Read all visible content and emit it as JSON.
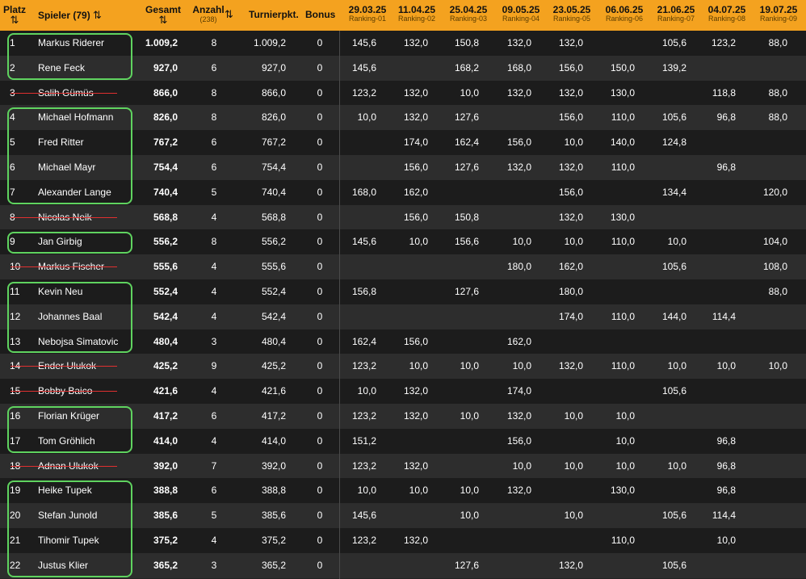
{
  "header": {
    "platz": "Platz",
    "spieler": "Spieler (79)",
    "gesamt": "Gesamt",
    "anzahl": "Anzahl",
    "anzahl_count": "(238)",
    "turnierpunkte": "Turnierpkt.",
    "bonus": "Bonus",
    "sort_symbol": "⇅",
    "rankings": [
      {
        "date": "29.03.25",
        "label": "Ranking-01"
      },
      {
        "date": "11.04.25",
        "label": "Ranking-02"
      },
      {
        "date": "25.04.25",
        "label": "Ranking-03"
      },
      {
        "date": "09.05.25",
        "label": "Ranking-04"
      },
      {
        "date": "23.05.25",
        "label": "Ranking-05"
      },
      {
        "date": "06.06.25",
        "label": "Ranking-06"
      },
      {
        "date": "21.06.25",
        "label": "Ranking-07"
      },
      {
        "date": "04.07.25",
        "label": "Ranking-08"
      },
      {
        "date": "19.07.25",
        "label": "Ranking-09"
      }
    ]
  },
  "colors": {
    "header_bg": "#f4a21f",
    "highlight_border": "#5fd35f",
    "strike": "#e03030"
  },
  "rows": [
    {
      "rank": "1",
      "name": "Markus Riderer",
      "total": "1.009,2",
      "count": "8",
      "points": "1.009,2",
      "bonus": "0",
      "r": [
        "145,6",
        "132,0",
        "150,8",
        "132,0",
        "132,0",
        "",
        "105,6",
        "123,2",
        "88,0"
      ],
      "struck": false
    },
    {
      "rank": "2",
      "name": "Rene Feck",
      "total": "927,0",
      "count": "6",
      "points": "927,0",
      "bonus": "0",
      "r": [
        "145,6",
        "",
        "168,2",
        "168,0",
        "156,0",
        "150,0",
        "139,2",
        "",
        ""
      ],
      "struck": false
    },
    {
      "rank": "3",
      "name": "Salih Gümüs",
      "total": "866,0",
      "count": "8",
      "points": "866,0",
      "bonus": "0",
      "r": [
        "123,2",
        "132,0",
        "10,0",
        "132,0",
        "132,0",
        "130,0",
        "",
        "118,8",
        "88,0"
      ],
      "struck": true
    },
    {
      "rank": "4",
      "name": "Michael Hofmann",
      "total": "826,0",
      "count": "8",
      "points": "826,0",
      "bonus": "0",
      "r": [
        "10,0",
        "132,0",
        "127,6",
        "",
        "156,0",
        "110,0",
        "105,6",
        "96,8",
        "88,0"
      ],
      "struck": false
    },
    {
      "rank": "5",
      "name": "Fred Ritter",
      "total": "767,2",
      "count": "6",
      "points": "767,2",
      "bonus": "0",
      "r": [
        "",
        "174,0",
        "162,4",
        "156,0",
        "10,0",
        "140,0",
        "124,8",
        "",
        ""
      ],
      "struck": false
    },
    {
      "rank": "6",
      "name": "Michael Mayr",
      "total": "754,4",
      "count": "6",
      "points": "754,4",
      "bonus": "0",
      "r": [
        "",
        "156,0",
        "127,6",
        "132,0",
        "132,0",
        "110,0",
        "",
        "96,8",
        ""
      ],
      "struck": false
    },
    {
      "rank": "7",
      "name": "Alexander Lange",
      "total": "740,4",
      "count": "5",
      "points": "740,4",
      "bonus": "0",
      "r": [
        "168,0",
        "162,0",
        "",
        "",
        "156,0",
        "",
        "134,4",
        "",
        "120,0"
      ],
      "struck": false
    },
    {
      "rank": "8",
      "name": "Nicolas Neik",
      "total": "568,8",
      "count": "4",
      "points": "568,8",
      "bonus": "0",
      "r": [
        "",
        "156,0",
        "150,8",
        "",
        "132,0",
        "130,0",
        "",
        "",
        ""
      ],
      "struck": true
    },
    {
      "rank": "9",
      "name": "Jan Girbig",
      "total": "556,2",
      "count": "8",
      "points": "556,2",
      "bonus": "0",
      "r": [
        "145,6",
        "10,0",
        "156,6",
        "10,0",
        "10,0",
        "110,0",
        "10,0",
        "",
        "104,0"
      ],
      "struck": false
    },
    {
      "rank": "10",
      "name": "Markus Fischer",
      "total": "555,6",
      "count": "4",
      "points": "555,6",
      "bonus": "0",
      "r": [
        "",
        "",
        "",
        "180,0",
        "162,0",
        "",
        "105,6",
        "",
        "108,0"
      ],
      "struck": true
    },
    {
      "rank": "11",
      "name": "Kevin Neu",
      "total": "552,4",
      "count": "4",
      "points": "552,4",
      "bonus": "0",
      "r": [
        "156,8",
        "",
        "127,6",
        "",
        "180,0",
        "",
        "",
        "",
        "88,0"
      ],
      "struck": false
    },
    {
      "rank": "12",
      "name": "Johannes Baal",
      "total": "542,4",
      "count": "4",
      "points": "542,4",
      "bonus": "0",
      "r": [
        "",
        "",
        "",
        "",
        "174,0",
        "110,0",
        "144,0",
        "114,4",
        ""
      ],
      "struck": false
    },
    {
      "rank": "13",
      "name": "Nebojsa Simatovic",
      "total": "480,4",
      "count": "3",
      "points": "480,4",
      "bonus": "0",
      "r": [
        "162,4",
        "156,0",
        "",
        "162,0",
        "",
        "",
        "",
        "",
        ""
      ],
      "struck": false
    },
    {
      "rank": "14",
      "name": "Ender Ulukok",
      "total": "425,2",
      "count": "9",
      "points": "425,2",
      "bonus": "0",
      "r": [
        "123,2",
        "10,0",
        "10,0",
        "10,0",
        "132,0",
        "110,0",
        "10,0",
        "10,0",
        "10,0"
      ],
      "struck": true
    },
    {
      "rank": "15",
      "name": "Bobby Baico",
      "total": "421,6",
      "count": "4",
      "points": "421,6",
      "bonus": "0",
      "r": [
        "10,0",
        "132,0",
        "",
        "174,0",
        "",
        "",
        "105,6",
        "",
        ""
      ],
      "struck": true
    },
    {
      "rank": "16",
      "name": "Florian Krüger",
      "total": "417,2",
      "count": "6",
      "points": "417,2",
      "bonus": "0",
      "r": [
        "123,2",
        "132,0",
        "10,0",
        "132,0",
        "10,0",
        "10,0",
        "",
        "",
        ""
      ],
      "struck": false
    },
    {
      "rank": "17",
      "name": "Tom Gröhlich",
      "total": "414,0",
      "count": "4",
      "points": "414,0",
      "bonus": "0",
      "r": [
        "151,2",
        "",
        "",
        "156,0",
        "",
        "10,0",
        "",
        "96,8",
        ""
      ],
      "struck": false
    },
    {
      "rank": "18",
      "name": "Adnan Ulukok",
      "total": "392,0",
      "count": "7",
      "points": "392,0",
      "bonus": "0",
      "r": [
        "123,2",
        "132,0",
        "",
        "10,0",
        "10,0",
        "10,0",
        "10,0",
        "96,8",
        ""
      ],
      "struck": true
    },
    {
      "rank": "19",
      "name": "Heike Tupek",
      "total": "388,8",
      "count": "6",
      "points": "388,8",
      "bonus": "0",
      "r": [
        "10,0",
        "10,0",
        "10,0",
        "132,0",
        "",
        "130,0",
        "",
        "96,8",
        ""
      ],
      "struck": false
    },
    {
      "rank": "20",
      "name": "Stefan Junold",
      "total": "385,6",
      "count": "5",
      "points": "385,6",
      "bonus": "0",
      "r": [
        "145,6",
        "",
        "10,0",
        "",
        "10,0",
        "",
        "105,6",
        "114,4",
        ""
      ],
      "struck": false
    },
    {
      "rank": "21",
      "name": "Tihomir Tupek",
      "total": "375,2",
      "count": "4",
      "points": "375,2",
      "bonus": "0",
      "r": [
        "123,2",
        "132,0",
        "",
        "",
        "",
        "110,0",
        "",
        "10,0",
        ""
      ],
      "struck": false
    },
    {
      "rank": "22",
      "name": "Justus Klier",
      "total": "365,2",
      "count": "3",
      "points": "365,2",
      "bonus": "0",
      "r": [
        "",
        "",
        "127,6",
        "",
        "132,0",
        "",
        "105,6",
        "",
        ""
      ],
      "struck": false
    }
  ]
}
